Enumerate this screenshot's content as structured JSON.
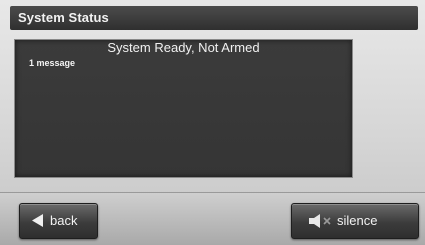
{
  "header": {
    "title": "System Status"
  },
  "status": {
    "headline": "System Ready, Not Armed",
    "message_count": "1 message"
  },
  "footer": {
    "back_label": "back",
    "silence_label": "silence"
  },
  "icons": {
    "back": "triangle-left-icon",
    "silence": "speaker-muted-icon"
  }
}
